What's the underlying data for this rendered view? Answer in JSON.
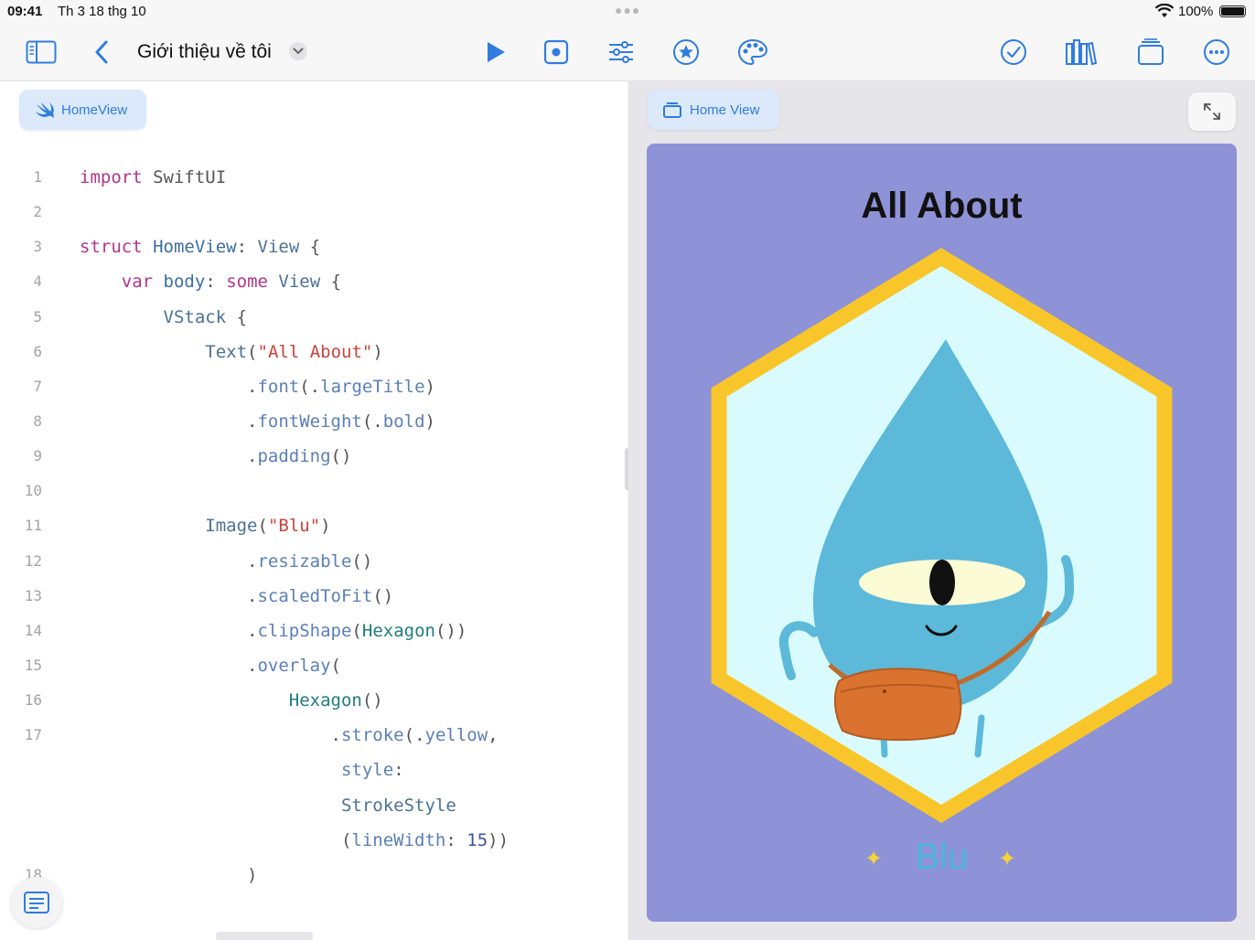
{
  "status_bar": {
    "time": "09:41",
    "date": "Th 3 18 thg 10",
    "battery": "100%"
  },
  "toolbar": {
    "title": "Giới thiệu về tôi",
    "icons": [
      "sidebar-icon",
      "back-icon",
      "play-icon",
      "record-icon",
      "sliders-icon",
      "star-icon",
      "palette-icon",
      "checkmark-icon",
      "library-icon",
      "copy-icon",
      "more-icon"
    ],
    "accent": "#2f7de0"
  },
  "editor": {
    "file_tab": "HomeView",
    "lines": [
      {
        "n": "1",
        "segs": [
          {
            "c": "kw",
            "t": "import"
          },
          {
            "c": "pl",
            "t": " SwiftUI"
          }
        ]
      },
      {
        "n": "2",
        "segs": []
      },
      {
        "n": "3",
        "segs": [
          {
            "c": "kw",
            "t": "struct"
          },
          {
            "c": "pl",
            "t": " "
          },
          {
            "c": "fn",
            "t": "HomeView"
          },
          {
            "c": "pl",
            "t": ": "
          },
          {
            "c": "tp",
            "t": "View"
          },
          {
            "c": "pl",
            "t": " {"
          }
        ]
      },
      {
        "n": "4",
        "segs": [
          {
            "c": "pl",
            "t": "    "
          },
          {
            "c": "kw",
            "t": "var"
          },
          {
            "c": "pl",
            "t": " "
          },
          {
            "c": "fn",
            "t": "body"
          },
          {
            "c": "pl",
            "t": ": "
          },
          {
            "c": "kw",
            "t": "some"
          },
          {
            "c": "pl",
            "t": " "
          },
          {
            "c": "tp",
            "t": "View"
          },
          {
            "c": "pl",
            "t": " {"
          }
        ]
      },
      {
        "n": "5",
        "segs": [
          {
            "c": "pl",
            "t": "        "
          },
          {
            "c": "tp",
            "t": "VStack"
          },
          {
            "c": "pl",
            "t": " {"
          }
        ]
      },
      {
        "n": "6",
        "segs": [
          {
            "c": "pl",
            "t": "            "
          },
          {
            "c": "tp",
            "t": "Text"
          },
          {
            "c": "pl",
            "t": "("
          },
          {
            "c": "st",
            "t": "\"All About\""
          },
          {
            "c": "pl",
            "t": ")"
          }
        ]
      },
      {
        "n": "7",
        "segs": [
          {
            "c": "pl",
            "t": "                ."
          },
          {
            "c": "md",
            "t": "font"
          },
          {
            "c": "pl",
            "t": "(."
          },
          {
            "c": "md",
            "t": "largeTitle"
          },
          {
            "c": "pl",
            "t": ")"
          }
        ]
      },
      {
        "n": "8",
        "segs": [
          {
            "c": "pl",
            "t": "                ."
          },
          {
            "c": "md",
            "t": "fontWeight"
          },
          {
            "c": "pl",
            "t": "(."
          },
          {
            "c": "md",
            "t": "bold"
          },
          {
            "c": "pl",
            "t": ")"
          }
        ]
      },
      {
        "n": "9",
        "segs": [
          {
            "c": "pl",
            "t": "                ."
          },
          {
            "c": "md",
            "t": "padding"
          },
          {
            "c": "pl",
            "t": "()"
          }
        ]
      },
      {
        "n": "10",
        "segs": []
      },
      {
        "n": "11",
        "segs": [
          {
            "c": "pl",
            "t": "            "
          },
          {
            "c": "tp",
            "t": "Image"
          },
          {
            "c": "pl",
            "t": "("
          },
          {
            "c": "st",
            "t": "\"Blu\""
          },
          {
            "c": "pl",
            "t": ")"
          }
        ]
      },
      {
        "n": "12",
        "segs": [
          {
            "c": "pl",
            "t": "                ."
          },
          {
            "c": "md",
            "t": "resizable"
          },
          {
            "c": "pl",
            "t": "()"
          }
        ]
      },
      {
        "n": "13",
        "segs": [
          {
            "c": "pl",
            "t": "                ."
          },
          {
            "c": "md",
            "t": "scaledToFit"
          },
          {
            "c": "pl",
            "t": "()"
          }
        ]
      },
      {
        "n": "14",
        "segs": [
          {
            "c": "pl",
            "t": "                ."
          },
          {
            "c": "md",
            "t": "clipShape"
          },
          {
            "c": "pl",
            "t": "("
          },
          {
            "c": "sf",
            "t": "Hexagon"
          },
          {
            "c": "pl",
            "t": "())"
          }
        ]
      },
      {
        "n": "15",
        "segs": [
          {
            "c": "pl",
            "t": "                ."
          },
          {
            "c": "md",
            "t": "overlay"
          },
          {
            "c": "pl",
            "t": "("
          }
        ]
      },
      {
        "n": "16",
        "segs": [
          {
            "c": "pl",
            "t": "                    "
          },
          {
            "c": "sf",
            "t": "Hexagon"
          },
          {
            "c": "pl",
            "t": "()"
          }
        ]
      },
      {
        "n": "17",
        "segs": [
          {
            "c": "pl",
            "t": "                        ."
          },
          {
            "c": "md",
            "t": "stroke"
          },
          {
            "c": "pl",
            "t": "(."
          },
          {
            "c": "md",
            "t": "yellow"
          },
          {
            "c": "pl",
            "t": ","
          }
        ]
      },
      {
        "n": "",
        "segs": [
          {
            "c": "pl",
            "t": "                         "
          },
          {
            "c": "md",
            "t": "style"
          },
          {
            "c": "pl",
            "t": ":"
          }
        ]
      },
      {
        "n": "",
        "segs": [
          {
            "c": "pl",
            "t": "                         "
          },
          {
            "c": "tp",
            "t": "StrokeStyle"
          }
        ]
      },
      {
        "n": "",
        "segs": [
          {
            "c": "pl",
            "t": "                         ("
          },
          {
            "c": "md",
            "t": "lineWidth"
          },
          {
            "c": "pl",
            "t": ": "
          },
          {
            "c": "nm",
            "t": "15"
          },
          {
            "c": "pl",
            "t": "))"
          }
        ]
      },
      {
        "n": "18",
        "segs": [
          {
            "c": "pl",
            "t": "                )"
          }
        ]
      }
    ]
  },
  "preview": {
    "view_tab": "Home View",
    "card": {
      "title": "All About",
      "name": "Blu",
      "sparkle": "✦",
      "background": "#8e92d6",
      "hexagon_stroke": "#f8c62a",
      "hexagon_fill": "#d9fbfd",
      "character_color": "#5cb9d9",
      "bag_color": "#d9732f"
    }
  }
}
